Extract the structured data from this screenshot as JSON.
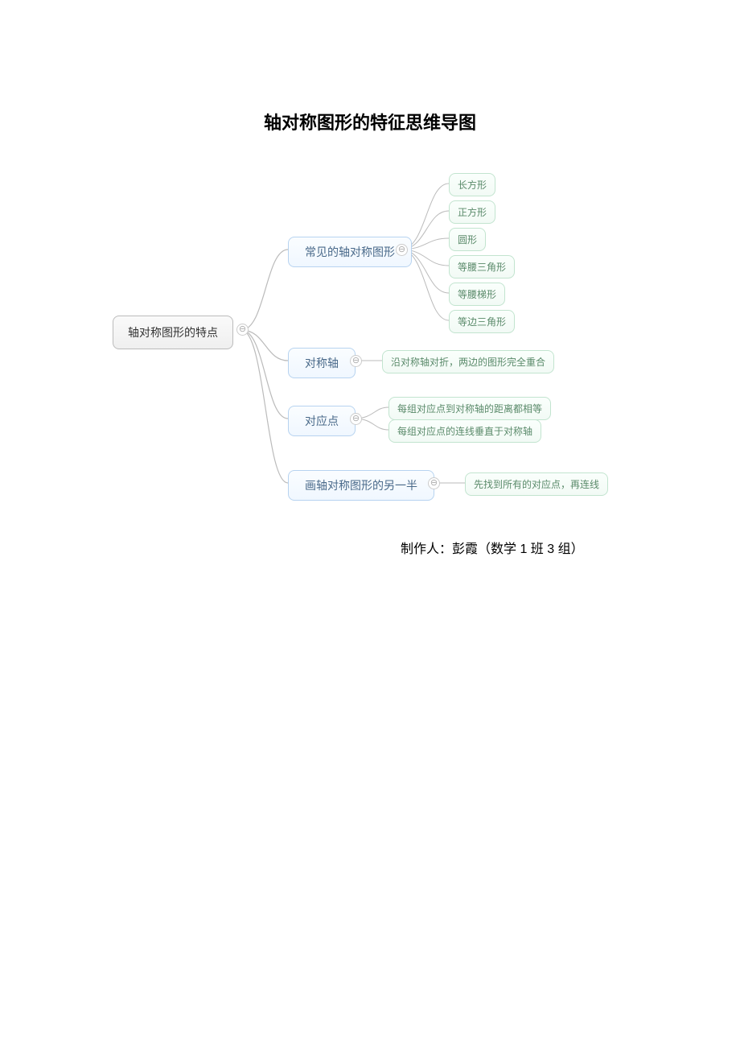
{
  "title": "轴对称图形的特征思维导图",
  "root": "轴对称图形的特点",
  "branches": [
    {
      "label": "常见的轴对称图形",
      "children": [
        "长方形",
        "正方形",
        "圆形",
        "等腰三角形",
        "等腰梯形",
        "等边三角形"
      ]
    },
    {
      "label": "对称轴",
      "children": [
        "沿对称轴对折，两边的图形完全重合"
      ]
    },
    {
      "label": "对应点",
      "children": [
        "每组对应点到对称轴的距离都相等",
        "每组对应点的连线垂直于对称轴"
      ]
    },
    {
      "label": "画轴对称图形的另一半",
      "children": [
        "先找到所有的对应点，再连线"
      ]
    }
  ],
  "credit": "制作人：彭霞（数学 1 班 3 组）",
  "toggle_glyph": "⊖"
}
